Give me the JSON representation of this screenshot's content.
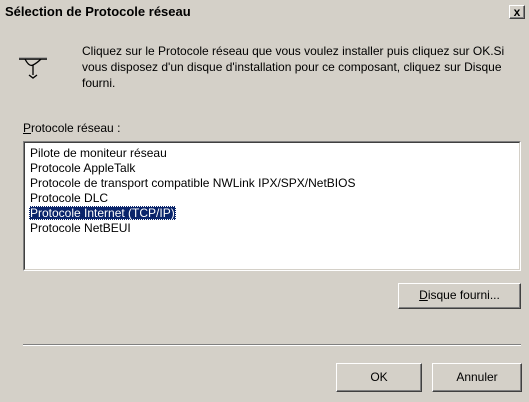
{
  "window": {
    "title": "Sélection de Protocole réseau",
    "close_glyph": "x"
  },
  "icon": {
    "name": "network-protocol-icon"
  },
  "description": "Cliquez sur le Protocole réseau que vous voulez installer puis cliquez sur OK.Si vous disposez d'un disque d'installation pour ce composant, cliquez sur Disque fourni.",
  "list": {
    "label_prefix": "P",
    "label_rest": "rotocole réseau :",
    "items": [
      "Pilote de moniteur réseau",
      "Protocole AppleTalk",
      "Protocole de transport compatible NWLink IPX/SPX/NetBIOS",
      "Protocole DLC",
      "Protocole Internet (TCP/IP)",
      "Protocole NetBEUI"
    ],
    "selected_index": 4
  },
  "buttons": {
    "disk_prefix": "D",
    "disk_rest": "isque fourni...",
    "ok": "OK",
    "cancel": "Annuler"
  },
  "colors": {
    "face": "#d4d0c8",
    "selection": "#0a246a"
  }
}
